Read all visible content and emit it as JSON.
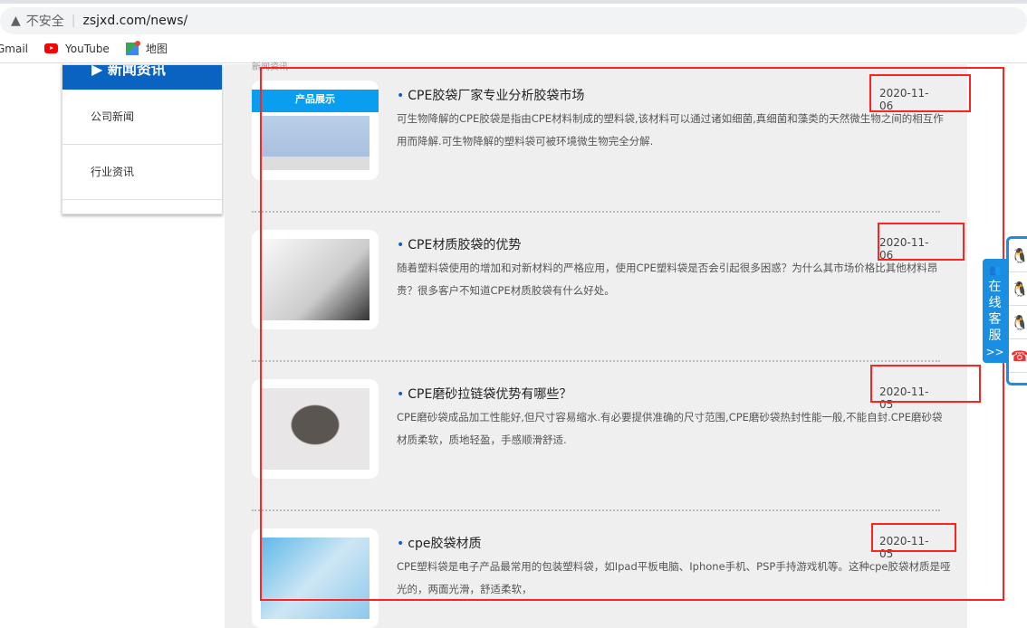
{
  "browser": {
    "security": "不安全",
    "url": "zsjxd.com/news/",
    "bookmarks": [
      "Gmail",
      "YouTube",
      "地图"
    ]
  },
  "sidebar": {
    "title": "新闻资讯",
    "items": [
      "公司新闻",
      "行业资讯"
    ]
  },
  "main": {
    "breadcrumb": "新闻资讯",
    "news": [
      {
        "title": "CPE胶袋厂家专业分析胶袋市场",
        "date": "2020-11-06",
        "desc": "可生物降解的CPE胶袋是指由CPE材料制成的塑料袋,该材料可以通过诸如细菌,真细菌和藻类的天然微生物之间的相互作用而降解.可生物降解的塑料袋可被环境微生物完全分解.",
        "thumb_text": "产品展示"
      },
      {
        "title": "CPE材质胶袋的优势",
        "date": "2020-11-06",
        "desc": "随着塑料袋使用的增加和对新材料的严格应用，使用CPE塑料袋是否会引起很多困惑？为什么其市场价格比其他材料昂贵？很多客户不知道CPE材质胶袋有什么好处。"
      },
      {
        "title": "CPE磨砂拉链袋优势有哪些？",
        "date": "2020-11-05",
        "desc": "CPE磨砂袋成品加工性能好,但尺寸容易缩水.有必要提供准确的尺寸范围,CPE磨砂袋热封性能一般,不能自封.CPE磨砂袋材质柔软，质地轻盈，手感顺滑舒适."
      },
      {
        "title": "cpe胶袋材质",
        "date": "2020-11-05",
        "desc": "CPE塑料袋是电子产品最常用的包装塑料袋，如Ipad平板电脑、Iphone手机、PSP手持游戏机等。这种cpe胶袋材质是哑光的，两面光滑，舒适柔软，"
      }
    ]
  },
  "service": {
    "label": "在线客服",
    "arrow": ">>"
  },
  "colors": {
    "accent": "#0a63c0",
    "highlight": "#ff2222",
    "service": "#1a8ee0"
  }
}
